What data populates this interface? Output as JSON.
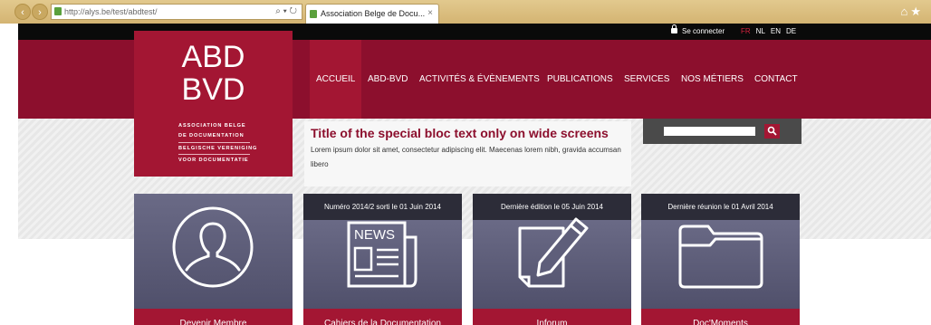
{
  "browser": {
    "url": "http://alys.be/test/abdtest/",
    "tab_title": "Association Belge de Docu..."
  },
  "topbar": {
    "login_label": "Se connecter",
    "languages": [
      "FR",
      "NL",
      "EN",
      "DE"
    ],
    "active_language": "FR"
  },
  "logo": {
    "line1": "ABD",
    "line2": "BVD",
    "sub": [
      "ASSOCIATION BELGE",
      "DE DOCUMENTATION",
      "BELGISCHE VERENIGING",
      "VOOR DOCUMENTATIE"
    ]
  },
  "nav": {
    "items": [
      "ACCUEIL",
      "ABD-BVD",
      "ACTIVITÉS & ÉVÈNEMENTS",
      "PUBLICATIONS",
      "SERVICES",
      "NOS MÉTIERS",
      "CONTACT"
    ],
    "active": "ACCUEIL"
  },
  "special_bloc": {
    "title": "Title of the special bloc text only on wide screens",
    "text": "Lorem ipsum dolor sit amet, consectetur adipiscing elit. Maecenas lorem nibh, gravida accumsan libero"
  },
  "search": {
    "placeholder": ""
  },
  "cards": [
    {
      "header": "",
      "label": "Devenir Membre",
      "icon": "user-icon"
    },
    {
      "header": "Numéro 2014/2 sorti le 01 Juin 2014",
      "label": "Cahiers de la Documentation",
      "icon": "newspaper-icon",
      "icon_text": "NEWS"
    },
    {
      "header": "Dernière édition le 05 Juin 2014",
      "label": "Inforum",
      "icon": "edit-document-icon"
    },
    {
      "header": "Dernière réunion le 01 Avril 2014",
      "label": "Doc'Moments",
      "icon": "folder-icon"
    }
  ],
  "colors": {
    "brand": "#8c0f2d",
    "brand_light": "#a31633",
    "card_bg": "#585875",
    "card_header": "#2c2c38"
  }
}
